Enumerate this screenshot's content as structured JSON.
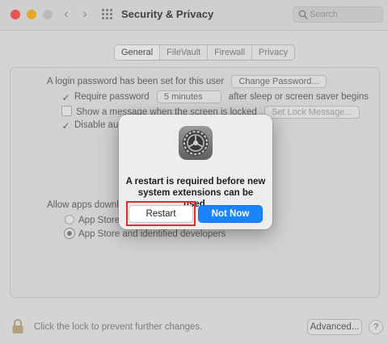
{
  "window": {
    "title": "Security & Privacy"
  },
  "search": {
    "placeholder": "Search"
  },
  "tabs": [
    {
      "label": "General"
    },
    {
      "label": "FileVault"
    },
    {
      "label": "Firewall"
    },
    {
      "label": "Privacy"
    }
  ],
  "general": {
    "login_text": "A login password has been set for this user",
    "change_password_label": "Change Password...",
    "require_password_label": "Require password",
    "require_password_value": "5 minutes",
    "require_password_suffix": "after sleep or screen saver begins",
    "show_message_label": "Show a message when the screen is locked",
    "set_lock_message_label": "Set Lock Message...",
    "disable_auto_label": "Disable auto",
    "allow_apps_label": "Allow apps downloa",
    "app_store_label": "App Store",
    "app_store_identified_label": "App Store and identified developers"
  },
  "footer": {
    "lock_text": "Click the lock to prevent further changes.",
    "advanced_label": "Advanced...",
    "help_label": "?"
  },
  "dialog": {
    "message": "A restart is required before new system extensions can be used.",
    "restart_label": "Restart",
    "not_now_label": "Not Now"
  },
  "icons": {
    "search": "search-icon",
    "lock": "lock-icon",
    "dialog": "system-preferences-gear-icon",
    "back": "chevron-left-icon",
    "forward": "chevron-right-icon",
    "grid": "grid-icon"
  },
  "colors": {
    "accent": "#1a84ff",
    "highlight": "#e32a2a"
  }
}
